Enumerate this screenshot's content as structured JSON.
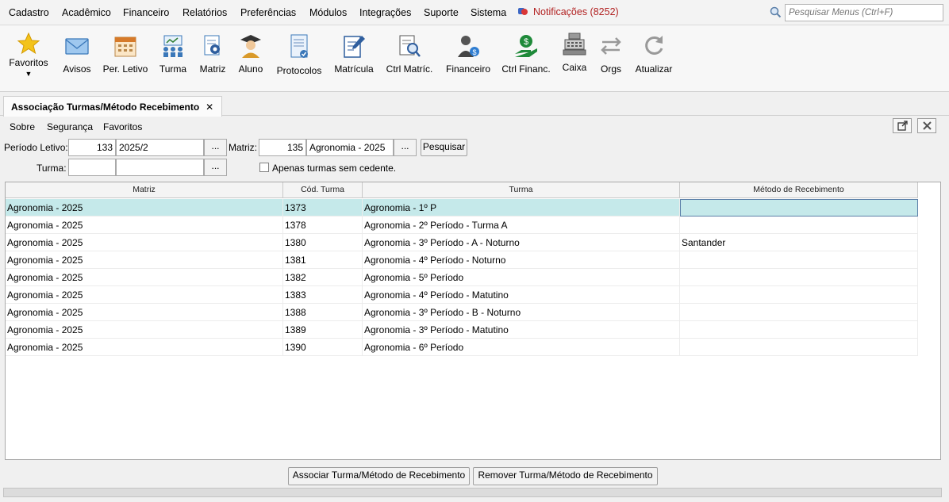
{
  "menu": {
    "items": [
      {
        "label": "Cadastro"
      },
      {
        "label": "Acadêmico"
      },
      {
        "label": "Financeiro"
      },
      {
        "label": "Relatórios"
      },
      {
        "label": "Preferências"
      },
      {
        "label": "Módulos"
      },
      {
        "label": "Integrações"
      },
      {
        "label": "Suporte"
      },
      {
        "label": "Sistema"
      }
    ],
    "notifications_label": "Notificações (8252)",
    "search_placeholder": "Pesquisar Menus (Ctrl+F)"
  },
  "toolbar": {
    "favoritos": "Favoritos",
    "avisos": "Avisos",
    "per_letivo": "Per. Letivo",
    "turma": "Turma",
    "matriz": "Matriz",
    "aluno": "Aluno",
    "protocolos": "Protocolos",
    "matricula": "Matrícula",
    "ctrl_matric": "Ctrl Matríc.",
    "financeiro": "Financeiro",
    "ctrl_financ": "Ctrl Financ.",
    "caixa": "Caixa",
    "orgs": "Orgs",
    "atualizar": "Atualizar"
  },
  "tab": {
    "title": "Associação Turmas/Método Recebimento",
    "close": "✕"
  },
  "submenu": {
    "sobre": "Sobre",
    "seguranca": "Segurança",
    "favoritos": "Favoritos"
  },
  "form": {
    "periodo_label": "Período Letivo:",
    "periodo_code": "133",
    "periodo_name": "2025/2",
    "matriz_label": "Matriz:",
    "matriz_code": "135",
    "matriz_name": "Agronomia - 2025",
    "dots": "...",
    "pesquisar": "Pesquisar",
    "turma_label": "Turma:",
    "turma_code": "",
    "turma_name": "",
    "apenas_label": "Apenas turmas sem cedente."
  },
  "grid": {
    "columns": [
      "Matriz",
      "Cód. Turma",
      "Turma",
      "Método de Recebimento"
    ],
    "rows": [
      {
        "matriz": "Agronomia - 2025",
        "cod": "1373",
        "turma": "Agronomia - 1º P",
        "metodo": ""
      },
      {
        "matriz": "Agronomia - 2025",
        "cod": "1378",
        "turma": "Agronomia - 2º Período - Turma A",
        "metodo": ""
      },
      {
        "matriz": "Agronomia - 2025",
        "cod": "1380",
        "turma": "Agronomia - 3º Período - A - Noturno",
        "metodo": "Santander"
      },
      {
        "matriz": "Agronomia - 2025",
        "cod": "1381",
        "turma": "Agronomia - 4º Período - Noturno",
        "metodo": ""
      },
      {
        "matriz": "Agronomia - 2025",
        "cod": "1382",
        "turma": "Agronomia - 5º Período",
        "metodo": ""
      },
      {
        "matriz": "Agronomia - 2025",
        "cod": "1383",
        "turma": "Agronomia - 4º Período - Matutino",
        "metodo": ""
      },
      {
        "matriz": "Agronomia - 2025",
        "cod": "1388",
        "turma": "Agronomia - 3º Período - B - Noturno",
        "metodo": ""
      },
      {
        "matriz": "Agronomia - 2025",
        "cod": "1389",
        "turma": "Agronomia - 3º Período - Matutino",
        "metodo": ""
      },
      {
        "matriz": "Agronomia - 2025",
        "cod": "1390",
        "turma": "Agronomia - 6º Período",
        "metodo": ""
      }
    ]
  },
  "actions": {
    "associar": "Associar Turma/Método de Recebimento",
    "remover": "Remover Turma/Método de Recebimento"
  }
}
